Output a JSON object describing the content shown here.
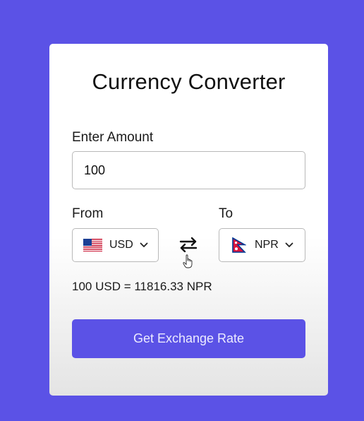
{
  "title": "Currency Converter",
  "amount": {
    "label": "Enter Amount",
    "value": "100"
  },
  "from": {
    "label": "From",
    "currency": "USD",
    "flag": "us-flag-icon"
  },
  "to": {
    "label": "To",
    "currency": "NPR",
    "flag": "nepal-flag-icon"
  },
  "result": "100 USD = 11816.33 NPR",
  "button_label": "Get Exchange Rate",
  "colors": {
    "background": "#5b52e6",
    "accent": "#5b52e6",
    "card": "#ffffff"
  }
}
